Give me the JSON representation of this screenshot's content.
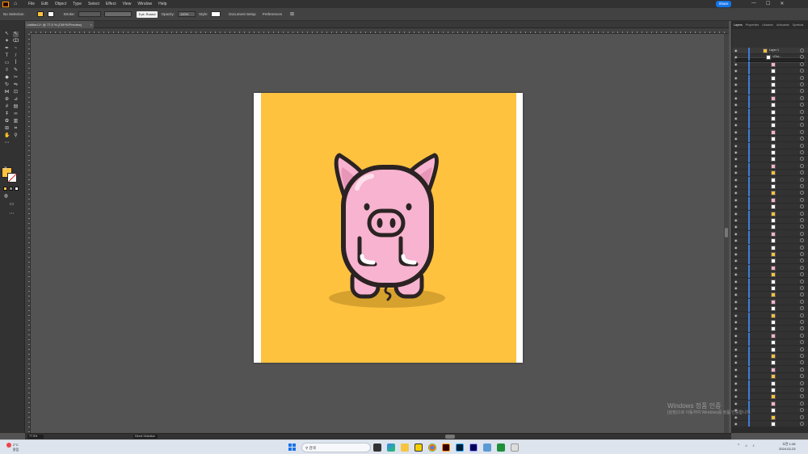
{
  "menubar": {
    "items": [
      "File",
      "Edit",
      "Object",
      "Type",
      "Select",
      "Effect",
      "View",
      "Window",
      "Help"
    ],
    "share_label": "Share",
    "window_controls": [
      "—",
      "☐",
      "✕"
    ]
  },
  "controlbar": {
    "selection_label": "No Selection",
    "fill_color": "#ffc23f",
    "stroke_label": "Stroke:",
    "brush_label": "5 pt. Round",
    "opacity_label": "Opacity:",
    "opacity_value": "100%",
    "style_label": "Style:",
    "doc_setup_label": "Document Setup",
    "preferences_label": "Preferences"
  },
  "document_tab": {
    "title": "Untitled-1* @ 77.5 % (CMYK/Preview)",
    "close": "×"
  },
  "toolbar": {
    "tools": [
      "selection",
      "direct-selection",
      "magic-wand",
      "lasso",
      "pen",
      "curvature",
      "type",
      "line",
      "rectangle",
      "paintbrush",
      "shaper",
      "pencil",
      "eraser",
      "scissors",
      "rotate",
      "reflect",
      "width",
      "free-transform",
      "shape-builder",
      "perspective",
      "mesh",
      "gradient",
      "eyedropper",
      "blend",
      "symbol-sprayer",
      "column-graph",
      "artboard",
      "slice",
      "hand",
      "zoom"
    ],
    "fill_color": "#ffc23f",
    "stroke_color": "#ffffff"
  },
  "artboard": {
    "background_color": "#ffc23f",
    "pig_color": "#f7b3cf",
    "pig_highlight": "#fde0ec",
    "outline_color": "#2b2323",
    "shadow_color": "#d7a12e"
  },
  "layers_panel": {
    "tabs": [
      "Layers",
      "Properties",
      "Libraries",
      "Artboards",
      "Symbols"
    ],
    "active_tab": "Layers",
    "layer_name": "Layer 1",
    "group_name": "<Gro...",
    "row_count": 56
  },
  "statusbar": {
    "zoom": "77.5%",
    "tool_label": "Direct Selection"
  },
  "watermark": {
    "line1": "Windows 정품 인증",
    "line2": "[설정]으로 이동하여 Windows를 정품 인증합니다."
  },
  "taskbar": {
    "weather_temp": "2°C",
    "weather_text": "맑음",
    "search_placeholder": "검색",
    "time": "오전 1:28",
    "date": "2024-02-23"
  }
}
